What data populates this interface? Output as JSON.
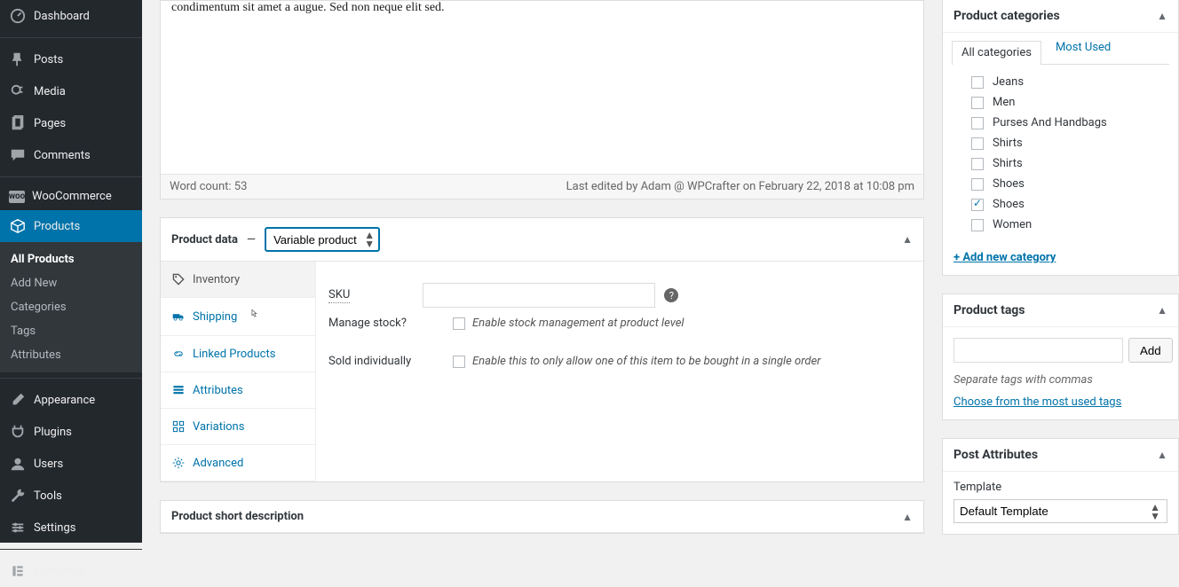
{
  "sidebar": {
    "items": [
      {
        "label": "Dashboard",
        "icon": "dashboard"
      },
      {
        "label": "Posts",
        "icon": "pin"
      },
      {
        "label": "Media",
        "icon": "media"
      },
      {
        "label": "Pages",
        "icon": "page"
      },
      {
        "label": "Comments",
        "icon": "comment"
      },
      {
        "label": "WooCommerce",
        "icon": "woo"
      },
      {
        "label": "Products",
        "icon": "box",
        "current": true
      },
      {
        "label": "Appearance",
        "icon": "brush"
      },
      {
        "label": "Plugins",
        "icon": "plug"
      },
      {
        "label": "Users",
        "icon": "users"
      },
      {
        "label": "Tools",
        "icon": "wrench"
      },
      {
        "label": "Settings",
        "icon": "gear"
      },
      {
        "label": "Elementor",
        "icon": "elementor"
      }
    ],
    "submenu": [
      {
        "label": "All Products",
        "active": true
      },
      {
        "label": "Add New"
      },
      {
        "label": "Categories"
      },
      {
        "label": "Tags"
      },
      {
        "label": "Attributes"
      }
    ]
  },
  "editor": {
    "placeholder_fragment": "condimentum sit amet a augue. Sed non neque elit sed.",
    "word_count_label": "Word count: 53",
    "last_edited": "Last edited by Adam @ WPCrafter on February 22, 2018 at 10:08 pm"
  },
  "product_data": {
    "title": "Product data",
    "type_options": [
      "Variable product"
    ],
    "selected_type": "Variable product",
    "tabs": [
      {
        "label": "Inventory",
        "icon": "tag",
        "active": true
      },
      {
        "label": "Shipping",
        "icon": "truck"
      },
      {
        "label": "Linked Products",
        "icon": "link"
      },
      {
        "label": "Attributes",
        "icon": "list"
      },
      {
        "label": "Variations",
        "icon": "grid"
      },
      {
        "label": "Advanced",
        "icon": "gear"
      }
    ],
    "fields": {
      "sku_label": "SKU",
      "sku_value": "",
      "manage_stock_label": "Manage stock?",
      "manage_stock_hint": "Enable stock management at product level",
      "sold_ind_label": "Sold individually",
      "sold_ind_hint": "Enable this to only allow one of this item to be bought in a single order"
    }
  },
  "short_desc": {
    "title": "Product short description"
  },
  "right": {
    "categories": {
      "title": "Product categories",
      "tabs": {
        "all": "All categories",
        "most": "Most Used"
      },
      "items": [
        {
          "label": "Jeans",
          "checked": false
        },
        {
          "label": "Men",
          "checked": false
        },
        {
          "label": "Purses And Handbags",
          "checked": false
        },
        {
          "label": "Shirts",
          "checked": false
        },
        {
          "label": "Shirts",
          "checked": false
        },
        {
          "label": "Shoes",
          "checked": false
        },
        {
          "label": "Shoes",
          "checked": true
        },
        {
          "label": "Women",
          "checked": false
        }
      ],
      "add_new": "+ Add new category"
    },
    "tags": {
      "title": "Product tags",
      "add_label": "Add",
      "input_value": "",
      "hint": "Separate tags with commas",
      "choose": "Choose from the most used tags"
    },
    "post_attr": {
      "title": "Post Attributes",
      "template_label": "Template",
      "template_value": "Default Template"
    }
  }
}
